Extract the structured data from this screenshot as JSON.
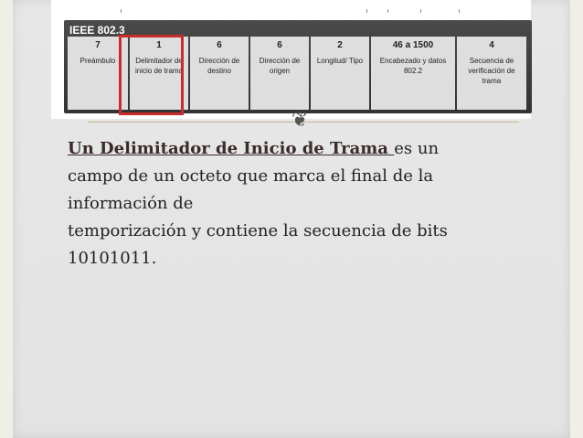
{
  "frame_diagram": {
    "standard": "IEEE 802.3",
    "fields": [
      {
        "bytes": "7",
        "name": "Preámbulo"
      },
      {
        "bytes": "1",
        "name": "Delimitador de inicio de trama"
      },
      {
        "bytes": "6",
        "name": "Dirección de destino"
      },
      {
        "bytes": "6",
        "name": "Dirección de origen"
      },
      {
        "bytes": "2",
        "name": "Longitud/ Tipo"
      },
      {
        "bytes": "46 a 1500",
        "name": "Encabezado y datos 802.2"
      },
      {
        "bytes": "4",
        "name": "Secuencia de verificación de trama"
      }
    ],
    "highlight_color": "#cc2b2b"
  },
  "ornament_glyph": "❦",
  "body": {
    "term": "Un Delimitador de Inicio de Trama ",
    "line1_rest": "es un",
    "line2": "campo de un octeto que marca el final de la",
    "line3": "información de",
    "line4": "temporización y contiene la secuencia de bits",
    "line5": "10101011."
  }
}
